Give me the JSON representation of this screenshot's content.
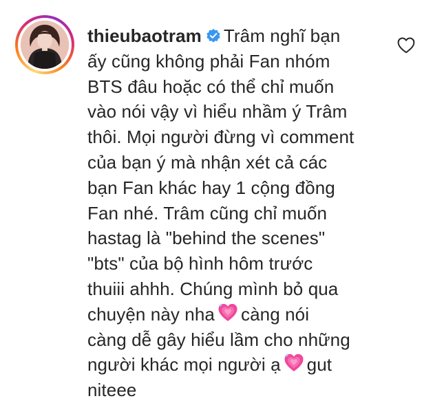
{
  "comment": {
    "username": "thieubaotram",
    "verified_icon": "verified-badge-icon",
    "like_icon": "heart-outline-icon",
    "emoji_icon": "growing-heart-emoji",
    "accent_verified": "#3897f0",
    "lines": [
      "Trâm nghĩ bạn",
      "ấy cũng không phải Fan nhóm",
      "BTS đâu hoặc có thể chỉ muốn",
      "vào nói vậy vì hiểu nhầm ý Trâm",
      "thôi. Mọi người đừng vì comment",
      "của bạn ý mà nhận xét cả các",
      "bạn Fan khác hay 1 cộng đồng",
      "Fan nhé. Trâm cũng chỉ muốn",
      "hastag là \"behind the scenes\"",
      "\"bts\" của bộ hình hôm trước",
      "thuiii ahhh. Chúng mình bỏ qua",
      "chuyện này nha",
      "càng nói",
      "càng dễ gây hiểu lầm cho những",
      "người khác mọi người ạ",
      "gut",
      "niteee"
    ]
  }
}
